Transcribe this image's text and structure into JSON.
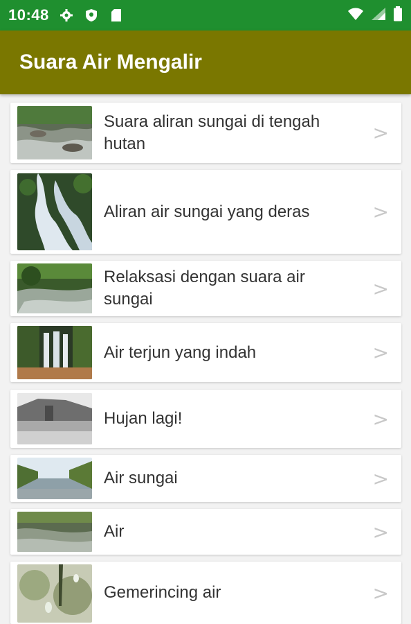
{
  "status_bar": {
    "time": "10:48",
    "left_icons": [
      "gear-icon",
      "shield-icon",
      "sim-card-icon"
    ],
    "right_icons": [
      "wifi-icon",
      "cell-signal-icon",
      "battery-icon"
    ]
  },
  "app_bar": {
    "title": "Suara Air Mengalir"
  },
  "list": {
    "items": [
      {
        "label": "Suara aliran sungai di tengah hutan",
        "chevron": ">",
        "thumb": "forest-stream"
      },
      {
        "label": "Aliran air sungai yang deras",
        "chevron": ">",
        "thumb": "waterfall-rocks"
      },
      {
        "label": "Relaksasi dengan suara air sungai",
        "chevron": ">",
        "thumb": "river-forest"
      },
      {
        "label": "Air terjun yang indah",
        "chevron": ">",
        "thumb": "waterfall"
      },
      {
        "label": "Hujan lagi!",
        "chevron": ">",
        "thumb": "rain"
      },
      {
        "label": "Air sungai",
        "chevron": ">",
        "thumb": "river"
      },
      {
        "label": "Air",
        "chevron": ">",
        "thumb": "stream"
      },
      {
        "label": "Gemerincing air",
        "chevron": ">",
        "thumb": "water-drops"
      }
    ]
  },
  "colors": {
    "status_bar": "#1f8f2f",
    "app_bar": "#7a7700",
    "background": "#f2f2f2"
  }
}
